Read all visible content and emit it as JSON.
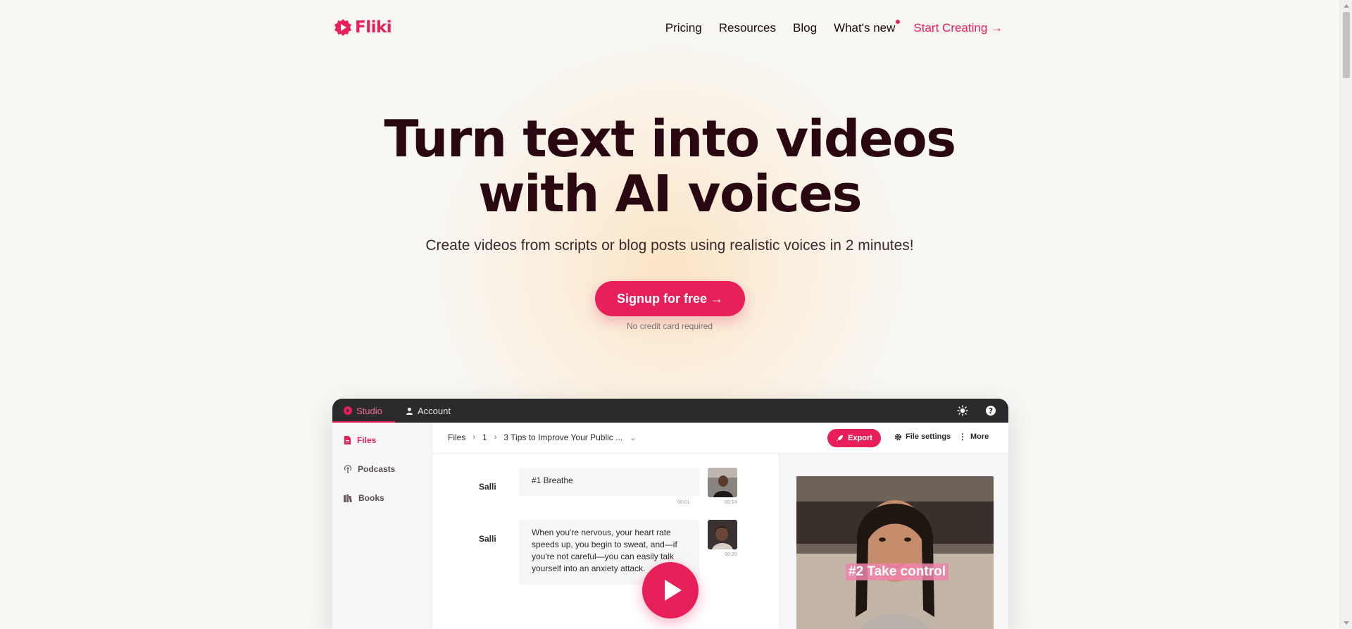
{
  "brand": {
    "name": "Fliki",
    "accent": "#e8205a"
  },
  "nav": {
    "links": [
      {
        "label": "Pricing"
      },
      {
        "label": "Resources"
      },
      {
        "label": "Blog"
      },
      {
        "label": "What's new"
      }
    ],
    "cta": "Start Creating →"
  },
  "hero": {
    "title_line1": "Turn text into videos",
    "title_line2": "with AI voices",
    "subtitle": "Create videos from scripts or blog posts using realistic voices in 2 minutes!",
    "signup_label": "Signup for free →",
    "note": "No credit card required"
  },
  "app": {
    "tabs": {
      "studio": "Studio",
      "account": "Account"
    },
    "sidebar": [
      {
        "label": "Files",
        "icon": "file-icon"
      },
      {
        "label": "Podcasts",
        "icon": "podcast-icon"
      },
      {
        "label": "Books",
        "icon": "books-icon"
      }
    ],
    "breadcrumb": {
      "root": "Files",
      "folder": "1",
      "file": "3 Tips to Improve Your Public ..."
    },
    "actions": {
      "export": "Export",
      "file_settings": "File settings",
      "more": "More"
    },
    "lines": [
      {
        "speaker": "Salli",
        "text": "#1 Breathe",
        "t1": "00:01",
        "t2": "00:14"
      },
      {
        "speaker": "Salli",
        "text": "When you're nervous, your heart rate speeds up, you begin to sweat, and—if you're not careful—you can easily talk yourself into an anxiety attack.",
        "t2": "00:20"
      }
    ],
    "preview_caption": "#2 Take control"
  }
}
